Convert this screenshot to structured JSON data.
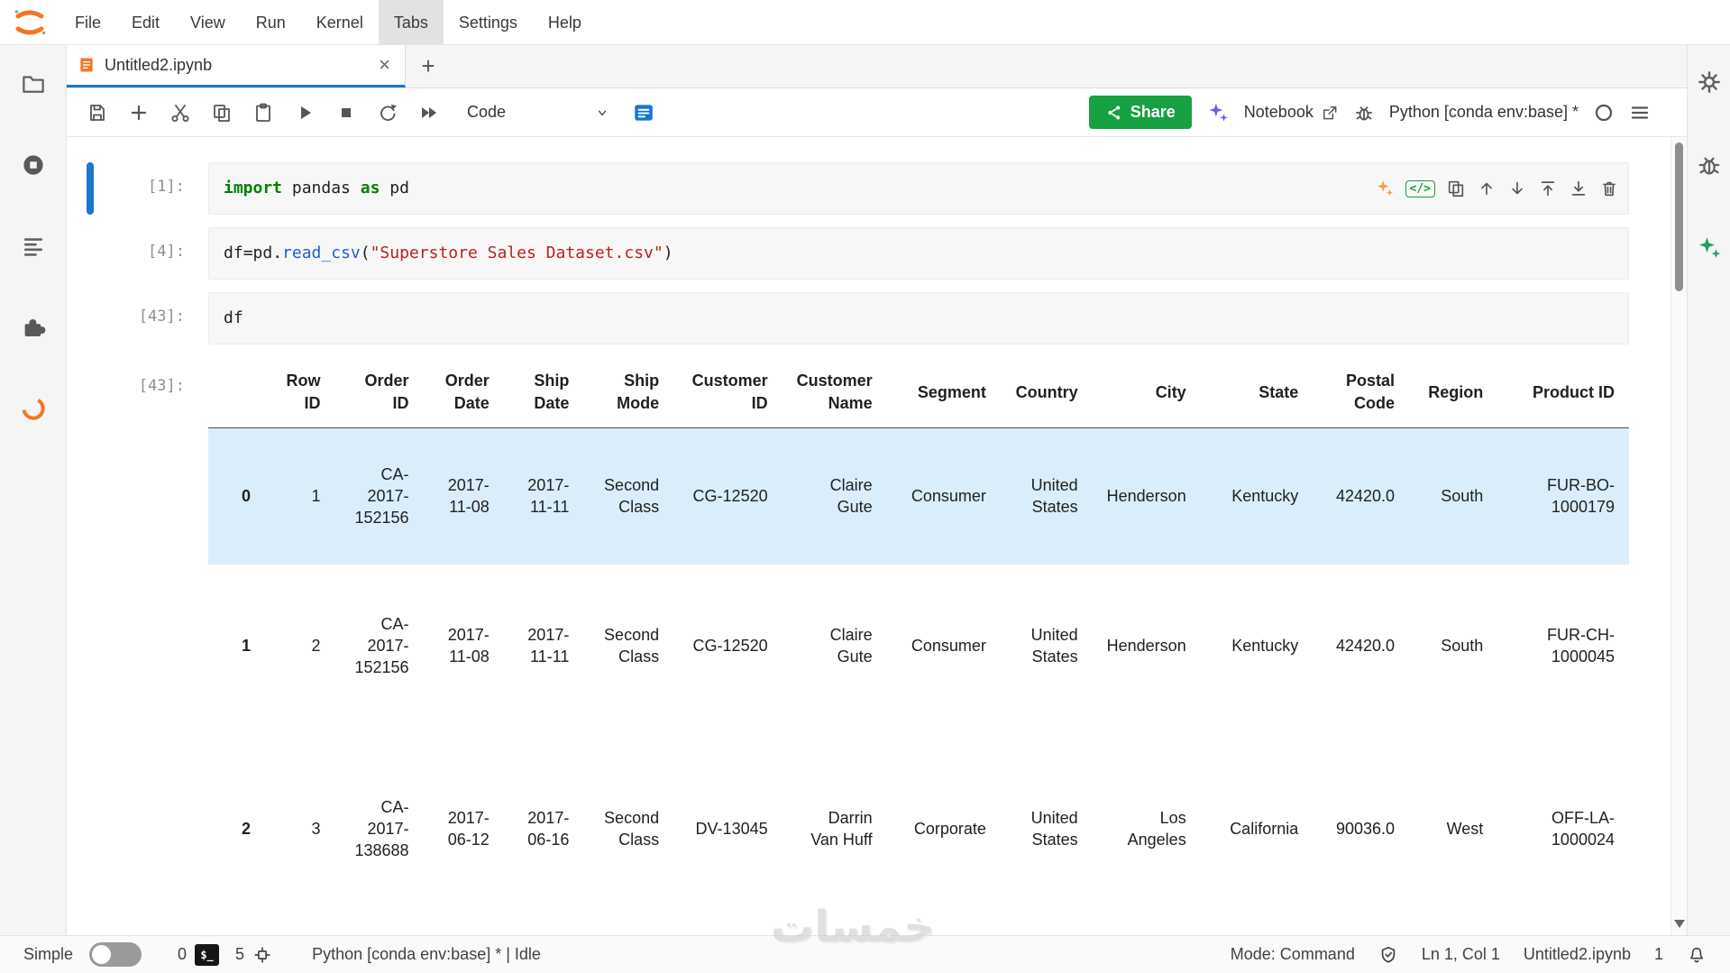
{
  "menu_bar": {
    "items": [
      {
        "label": "File",
        "active": false
      },
      {
        "label": "Edit",
        "active": false
      },
      {
        "label": "View",
        "active": false
      },
      {
        "label": "Run",
        "active": false
      },
      {
        "label": "Kernel",
        "active": false
      },
      {
        "label": "Tabs",
        "active": true
      },
      {
        "label": "Settings",
        "active": false
      },
      {
        "label": "Help",
        "active": false
      }
    ]
  },
  "tab_bar": {
    "tabs": [
      {
        "label": "Untitled2.ipynb",
        "active": true
      }
    ],
    "new_tab_label": "+"
  },
  "toolbar": {
    "cell_type": "Code",
    "share_label": "Share",
    "notebook_link_label": "Notebook",
    "kernel_name": "Python [conda env:base] *"
  },
  "cells": [
    {
      "prompt": "[1]:",
      "active": true,
      "tokens": [
        {
          "text": "import",
          "cls": "kw"
        },
        {
          "text": " pandas ",
          "cls": "pl"
        },
        {
          "text": "as",
          "cls": "kw"
        },
        {
          "text": " pd",
          "cls": "pl"
        }
      ]
    },
    {
      "prompt": "[4]:",
      "active": false,
      "tokens": [
        {
          "text": "df",
          "cls": "pl"
        },
        {
          "text": "=",
          "cls": "pl"
        },
        {
          "text": "pd.",
          "cls": "pl"
        },
        {
          "text": "read_csv",
          "cls": "fn"
        },
        {
          "text": "(",
          "cls": "pl"
        },
        {
          "text": "\"Superstore Sales Dataset.csv\"",
          "cls": "st"
        },
        {
          "text": ")",
          "cls": "pl"
        }
      ]
    },
    {
      "prompt": "[43]:",
      "active": false,
      "tokens": [
        {
          "text": "df",
          "cls": "pl"
        }
      ]
    }
  ],
  "output": {
    "prompt": "[43]:",
    "dataframe": {
      "columns": [
        "",
        "Row ID",
        "Order ID",
        "Order Date",
        "Ship Date",
        "Ship Mode",
        "Customer ID",
        "Customer Name",
        "Segment",
        "Country",
        "City",
        "State",
        "Postal Code",
        "Region",
        "Product ID"
      ],
      "rows": [
        {
          "highlight": true,
          "cells": [
            "0",
            "1",
            "CA-2017-152156",
            "2017-11-08",
            "2017-11-11",
            "Second Class",
            "CG-12520",
            "Claire Gute",
            "Consumer",
            "United States",
            "Henderson",
            "Kentucky",
            "42420.0",
            "South",
            "FUR-BO-1000179"
          ]
        },
        {
          "highlight": false,
          "cells": [
            "1",
            "2",
            "CA-2017-152156",
            "2017-11-08",
            "2017-11-11",
            "Second Class",
            "CG-12520",
            "Claire Gute",
            "Consumer",
            "United States",
            "Henderson",
            "Kentucky",
            "42420.0",
            "South",
            "FUR-CH-1000045"
          ]
        },
        {
          "highlight": false,
          "cells": [
            "2",
            "3",
            "CA-2017-138688",
            "2017-06-12",
            "2017-06-16",
            "Second Class",
            "DV-13045",
            "Darrin Van Huff",
            "Corporate",
            "United States",
            "Los Angeles",
            "California",
            "90036.0",
            "West",
            "OFF-LA-1000024"
          ]
        }
      ]
    }
  },
  "status_bar": {
    "simple_label": "Simple",
    "terminals_count": "0",
    "kernels_count": "5",
    "kernel_status": "Python [conda env:base] * | Idle",
    "mode": "Mode: Command",
    "cursor_position": "Ln 1, Col 1",
    "file_name": "Untitled2.ipynb",
    "notifications_count": "1"
  },
  "watermark": "خمسات",
  "colors": {
    "accent_blue": "#1976d2",
    "share_green": "#18a142",
    "jupyter_orange": "#f37626",
    "row_highlight": "#d9eefa"
  }
}
